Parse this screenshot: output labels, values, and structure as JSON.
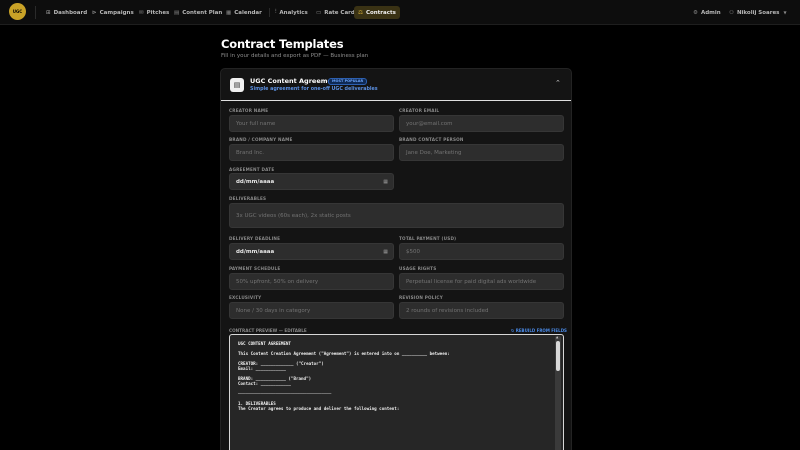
{
  "nav": {
    "logo": "UGC",
    "items": [
      {
        "label": "Dashboard",
        "icon": "grid-icon",
        "glyph": "⊞"
      },
      {
        "label": "Campaigns",
        "icon": "megaphone-icon",
        "glyph": "⊳"
      },
      {
        "label": "Pitches",
        "icon": "mail-icon",
        "glyph": "✉"
      },
      {
        "label": "Content Plan",
        "icon": "document-icon",
        "glyph": "▤"
      },
      {
        "label": "Calendar",
        "icon": "calendar-icon",
        "glyph": "▦"
      },
      {
        "label": "Analytics",
        "icon": "chart-icon",
        "glyph": "⫶"
      },
      {
        "label": "Rate Card",
        "icon": "card-icon",
        "glyph": "▭"
      },
      {
        "label": "Contracts",
        "icon": "contract-icon",
        "glyph": "⚖"
      }
    ],
    "admin": "Admin",
    "admin_glyph": "⚙",
    "user": "Nikolij Soares",
    "user_glyph": "⚇"
  },
  "page": {
    "title": "Contract Templates",
    "subtitle": "Fill in your details and export as PDF — Business plan"
  },
  "template": {
    "title": "UGC Content Agreement",
    "badge": "MOST POPULAR",
    "subtitle": "Simple agreement for one-off UGC deliverables",
    "doc_glyph": "▤",
    "chevron_glyph": "⌃"
  },
  "fields": {
    "creator_name": {
      "label": "CREATOR NAME",
      "placeholder": "Your full name"
    },
    "creator_email": {
      "label": "CREATOR EMAIL",
      "placeholder": "your@email.com"
    },
    "brand_name": {
      "label": "BRAND / COMPANY NAME",
      "placeholder": "Brand Inc."
    },
    "brand_contact": {
      "label": "BRAND CONTACT PERSON",
      "placeholder": "Jane Doe, Marketing"
    },
    "agreement_date": {
      "label": "AGREEMENT DATE",
      "value": "dd/mm/aaaa"
    },
    "deliverables": {
      "label": "DELIVERABLES",
      "placeholder": "3x UGC videos (60s each), 2x static posts"
    },
    "delivery_deadline": {
      "label": "DELIVERY DEADLINE",
      "value": "dd/mm/aaaa"
    },
    "total_payment": {
      "label": "TOTAL PAYMENT (USD)",
      "placeholder": "$500"
    },
    "payment_schedule": {
      "label": "PAYMENT SCHEDULE",
      "placeholder": "50% upfront, 50% on delivery"
    },
    "usage_rights": {
      "label": "USAGE RIGHTS",
      "placeholder": "Perpetual license for paid digital ads worldwide"
    },
    "exclusivity": {
      "label": "EXCLUSIVITY",
      "placeholder": "None / 30 days in category"
    },
    "revision_policy": {
      "label": "REVISION POLICY",
      "placeholder": "2 rounds of revisions included"
    }
  },
  "calendar_glyph": "▦",
  "preview": {
    "label": "CONTRACT PREVIEW — EDITABLE",
    "rebuild": "↻ REBUILD FROM FIELDS",
    "text": "UGC CONTENT AGREEMENT\n\nThis Content Creation Agreement (\"Agreement\") is entered into on __________ between:\n\nCREATOR: _____________ (\"Creator\")\nEmail: ____________\n\nBRAND: ____________ (\"Brand\")\nContact: ____________\n\n─────────────────────────────────────\n\n1. DELIVERABLES\nThe Creator agrees to produce and deliver the following content:"
  },
  "colors": {
    "accent": "#c9a227",
    "link": "#4b8be8",
    "background": "#000000",
    "card": "#141414",
    "input": "#2d2d2d"
  }
}
